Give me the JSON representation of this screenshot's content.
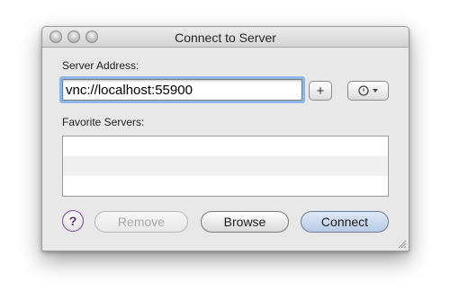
{
  "window": {
    "title": "Connect to Server"
  },
  "form": {
    "server_address_label": "Server Address:",
    "server_address_value": "vnc://localhost:55900",
    "favorite_servers_label": "Favorite Servers:"
  },
  "toolbar": {
    "add_label": "+"
  },
  "favorites": {
    "rows": [
      "",
      "",
      ""
    ]
  },
  "buttons": {
    "help_label": "?",
    "remove_label": "Remove",
    "browse_label": "Browse",
    "connect_label": "Connect"
  },
  "colors": {
    "focus_ring": "#8fb4e6",
    "help_accent": "#5a2d7a",
    "connect_default": "#b8cbe6"
  }
}
